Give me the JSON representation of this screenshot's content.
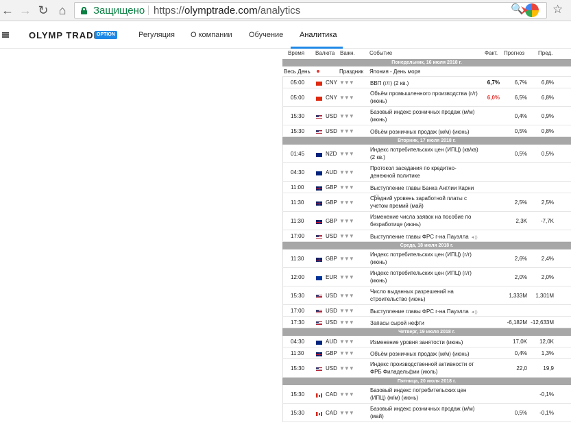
{
  "browser": {
    "secure_label": "Защищено",
    "url_scheme": "https://",
    "url_host": "olymptrade.com",
    "url_path": "/analytics"
  },
  "site": {
    "logo": "OLYMP TRADE",
    "logo_badge": "OPTION",
    "nav": [
      "Регуляция",
      "О компании",
      "Обучение",
      "Аналитика"
    ],
    "active_nav": "Аналитика"
  },
  "calendar": {
    "headers": {
      "time": "Время",
      "currency": "Валюта",
      "importance": "Важн.",
      "event": "Событие",
      "actual": "Факт.",
      "forecast": "Прогноз",
      "previous": "Пред."
    },
    "days": [
      {
        "label": "Понедельник, 16 июля 2018 г.",
        "holiday": {
          "time": "Весь День",
          "type": "Праздник",
          "event": "Япония - День моря"
        },
        "events": [
          {
            "time": "05:00",
            "flag": "cn",
            "currency": "CNY",
            "event": "ВВП (г/г) (2 кв.)",
            "actual": "6,7%",
            "actual_color": "#111111",
            "forecast": "6,7%",
            "previous": "6,8%"
          },
          {
            "time": "05:00",
            "flag": "cn",
            "currency": "CNY",
            "event": "Объём промышленного производства (г/г) (июнь)",
            "actual": "6,0%",
            "actual_color": "#e53935",
            "forecast": "6,5%",
            "previous": "6,8%"
          },
          {
            "time": "15:30",
            "flag": "us",
            "currency": "USD",
            "event": "Базовый индекс розничных продаж (м/м) (июнь)",
            "actual": "",
            "forecast": "0,4%",
            "previous": "0,9%"
          },
          {
            "time": "15:30",
            "flag": "us",
            "currency": "USD",
            "event": "Объём розничных продаж (м/м) (июнь)",
            "actual": "",
            "forecast": "0,5%",
            "previous": "0,8%"
          }
        ]
      },
      {
        "label": "Вторник, 17 июля 2018 г.",
        "events": [
          {
            "time": "01:45",
            "flag": "nz",
            "currency": "NZD",
            "event": "Индекс потребительских цен (ИПЦ) (кв/кв) (2 кв.)",
            "actual": "",
            "forecast": "0,5%",
            "previous": "0,5%"
          },
          {
            "time": "04:30",
            "flag": "au",
            "currency": "AUD",
            "event": "Протокол заседания по кредитно-денежной политике",
            "actual": "",
            "forecast": "",
            "previous": ""
          },
          {
            "time": "11:00",
            "flag": "gb",
            "currency": "GBP",
            "event": "Выступление главы Банка Англии Карни",
            "speech": true,
            "actual": "",
            "forecast": "",
            "previous": ""
          },
          {
            "time": "11:30",
            "flag": "gb",
            "currency": "GBP",
            "event": "Средний уровень заработной платы с учетом премий (май)",
            "actual": "",
            "forecast": "2,5%",
            "previous": "2,5%"
          },
          {
            "time": "11:30",
            "flag": "gb",
            "currency": "GBP",
            "event": "Изменение числа заявок на пособие по безработице (июнь)",
            "actual": "",
            "forecast": "2,3K",
            "previous": "-7,7K"
          },
          {
            "time": "17:00",
            "flag": "us",
            "currency": "USD",
            "event": "Выступление главы ФРС г-на Пауэлла",
            "speech": true,
            "actual": "",
            "forecast": "",
            "previous": ""
          }
        ]
      },
      {
        "label": "Среда, 18 июля 2018 г.",
        "events": [
          {
            "time": "11:30",
            "flag": "gb",
            "currency": "GBP",
            "event": "Индекс потребительских цен (ИПЦ) (г/г) (июнь)",
            "actual": "",
            "forecast": "2,6%",
            "previous": "2,4%"
          },
          {
            "time": "12:00",
            "flag": "eu",
            "currency": "EUR",
            "event": "Индекс потребительских цен (ИПЦ) (г/г) (июнь)",
            "actual": "",
            "forecast": "2,0%",
            "previous": "2,0%"
          },
          {
            "time": "15:30",
            "flag": "us",
            "currency": "USD",
            "event": "Число выданных разрешений на строительство (июнь)",
            "actual": "",
            "forecast": "1,333M",
            "previous": "1,301M"
          },
          {
            "time": "17:00",
            "flag": "us",
            "currency": "USD",
            "event": "Выступление главы ФРС г-на Пауэлла",
            "speech": true,
            "actual": "",
            "forecast": "",
            "previous": ""
          },
          {
            "time": "17:30",
            "flag": "us",
            "currency": "USD",
            "event": "Запасы сырой нефти",
            "actual": "",
            "forecast": "-6,182M",
            "previous": "-12,633M"
          }
        ]
      },
      {
        "label": "Четверг, 19 июля 2018 г.",
        "events": [
          {
            "time": "04:30",
            "flag": "au",
            "currency": "AUD",
            "event": "Изменение уровня занятости (июнь)",
            "actual": "",
            "forecast": "17,0K",
            "previous": "12,0K"
          },
          {
            "time": "11:30",
            "flag": "gb",
            "currency": "GBP",
            "event": "Объём розничных продаж (м/м) (июнь)",
            "actual": "",
            "forecast": "0,4%",
            "previous": "1,3%"
          },
          {
            "time": "15:30",
            "flag": "us",
            "currency": "USD",
            "event": "Индекс производственной активности от ФРБ Филадельфии (июль)",
            "actual": "",
            "forecast": "22,0",
            "previous": "19,9"
          }
        ]
      },
      {
        "label": "Пятница, 20 июля 2018 г.",
        "events": [
          {
            "time": "15:30",
            "flag": "ca",
            "currency": "CAD",
            "event": "Базовый индекс потребительских цен (ИПЦ) (м/м) (июнь)",
            "actual": "",
            "forecast": "",
            "previous": "-0,1%"
          },
          {
            "time": "15:30",
            "flag": "ca",
            "currency": "CAD",
            "event": "Базовый индекс розничных продаж (м/м) (май)",
            "actual": "",
            "forecast": "0,5%",
            "previous": "-0,1%"
          }
        ]
      }
    ]
  }
}
